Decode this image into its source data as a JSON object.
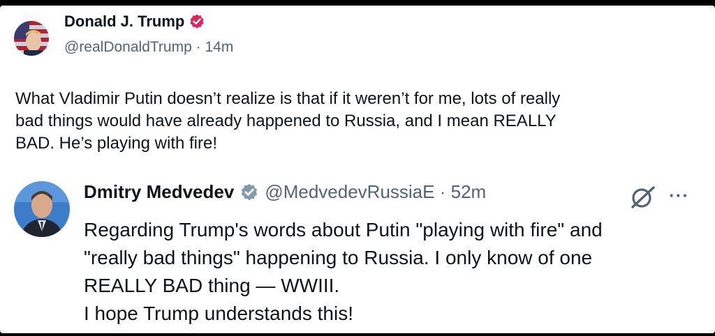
{
  "post": {
    "author_name": "Donald J. Trump",
    "handle": "@realDonaldTrump",
    "separator": "·",
    "time": "14m",
    "verified_icon": "verified-badge-icon",
    "text_lines": [
      "What Vladimir Putin doesn’t realize is that if it weren’t for me, lots of really",
      "bad things would have already happened to Russia, and I mean REALLY",
      "BAD. He’s playing with fire!"
    ]
  },
  "quoted_post": {
    "author_name": "Dmitry Medvedev",
    "handle": "@MedvedevRussiaE",
    "separator": "·",
    "time": "52m",
    "verified_icon": "verified-badge-icon",
    "actions": [
      "grok-icon",
      "more-options-icon"
    ],
    "more_label": "···",
    "text_lines": [
      "Regarding Trump's words about Putin \"playing with fire\" and",
      "\"really bad things\" happening to Russia. I only know of one",
      "REALLY BAD thing — WWIII.",
      "I hope Trump understands this!"
    ]
  },
  "colors": {
    "text": "#0f1419",
    "secondary": "#536471",
    "verified_pink": "#e0245e",
    "verified_gray": "#829aab"
  }
}
